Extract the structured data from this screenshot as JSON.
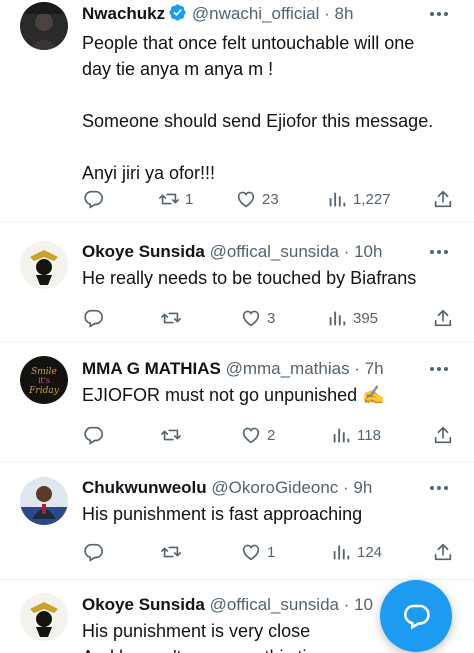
{
  "tweets": [
    {
      "display_name": "Nwachukz",
      "handle": "@nwachi_official",
      "time": "8h",
      "verified": true,
      "lines": [
        "People that once felt untouchable will one",
        "day tie anya m anya m !",
        "",
        "Someone should send Ejiofor this message.",
        "",
        "Anyi jiri ya ofor!!!"
      ],
      "replies": "",
      "retweets": "1",
      "likes": "23",
      "views": "1,227"
    },
    {
      "display_name": "Okoye Sunsida",
      "handle": "@offical_sunsida",
      "time": "10h",
      "lines": [
        "He really needs to be touched by Biafrans"
      ],
      "replies": "",
      "retweets": "",
      "likes": "3",
      "views": "395"
    },
    {
      "display_name": "MMA G MATHIAS",
      "handle": "@mma_mathias",
      "time": "7h",
      "lines": [
        "EJIOFOR must not go unpunished ✍️"
      ],
      "replies": "",
      "retweets": "",
      "likes": "2",
      "views": "118"
    },
    {
      "display_name": "Chukwunweolu",
      "handle": "@OkoroGideonc",
      "time": "9h",
      "lines": [
        "His punishment is fast approaching"
      ],
      "replies": "",
      "retweets": "",
      "likes": "1",
      "views": "124"
    },
    {
      "display_name": "Okoye Sunsida",
      "handle": "@offical_sunsida",
      "time": "10",
      "lines": [
        "His punishment is very close",
        "And he can't run away this time"
      ],
      "replies": "",
      "retweets": "",
      "likes": "",
      "views": ""
    }
  ],
  "separator": " · ",
  "colors": {
    "accent": "#1d9bf0",
    "text": "#0f1419",
    "secondary": "#536471",
    "divider": "#eff3f4"
  },
  "icons": [
    "more-icon",
    "reply-icon",
    "retweet-icon",
    "like-icon",
    "views-icon",
    "share-icon",
    "verified-badge-icon",
    "compose-reply-icon"
  ]
}
